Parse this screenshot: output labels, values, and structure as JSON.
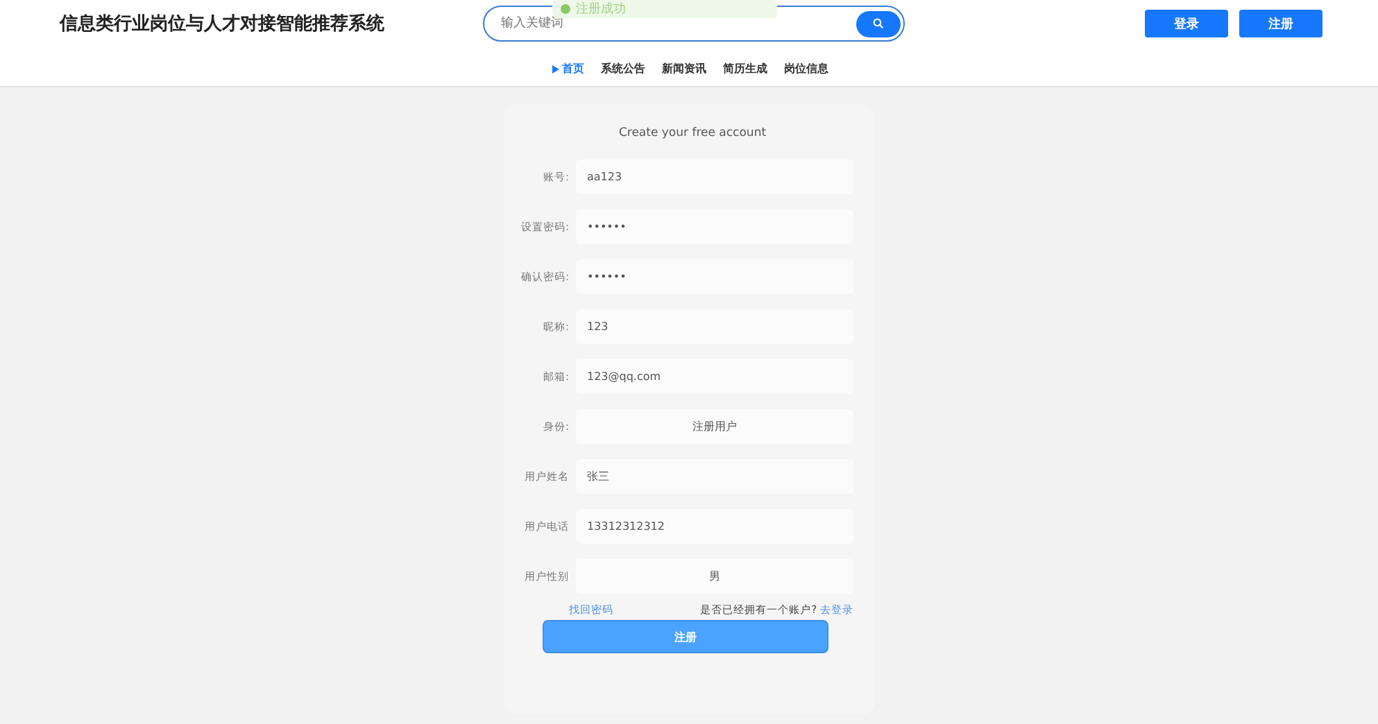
{
  "site_title": "信息类行业岗位与人才对接智能推荐系统",
  "search": {
    "placeholder": "输入关键词"
  },
  "toast": "注册成功",
  "header_buttons": [
    "登录",
    "注册"
  ],
  "nav": [
    {
      "label": "首页",
      "selected": true
    },
    {
      "label": "系统公告",
      "selected": false
    },
    {
      "label": "新闻资讯",
      "selected": false
    },
    {
      "label": "简历生成",
      "selected": false
    },
    {
      "label": "岗位信息",
      "selected": false
    }
  ],
  "form": {
    "title": "Create your free account",
    "fields": [
      {
        "label": "账号:",
        "value": "aa123",
        "kind": "input"
      },
      {
        "label": "设置密码:",
        "value": "••••••",
        "kind": "input"
      },
      {
        "label": "确认密码:",
        "value": "••••••",
        "kind": "input"
      },
      {
        "label": "昵称:",
        "value": "123",
        "kind": "input"
      },
      {
        "label": "邮箱:",
        "value": "123@qq.com",
        "kind": "input"
      },
      {
        "label": "身份:",
        "value": "注册用户",
        "kind": "select"
      },
      {
        "label": "用户姓名",
        "value": "张三",
        "kind": "input"
      },
      {
        "label": "用户电话",
        "value": "13312312312",
        "kind": "input"
      },
      {
        "label": "用户性别",
        "value": "男",
        "kind": "select"
      }
    ],
    "forgot_link": "找回密码",
    "have_account": "是否已经拥有一个账户?",
    "login_link": "去登录",
    "submit": "注册"
  }
}
